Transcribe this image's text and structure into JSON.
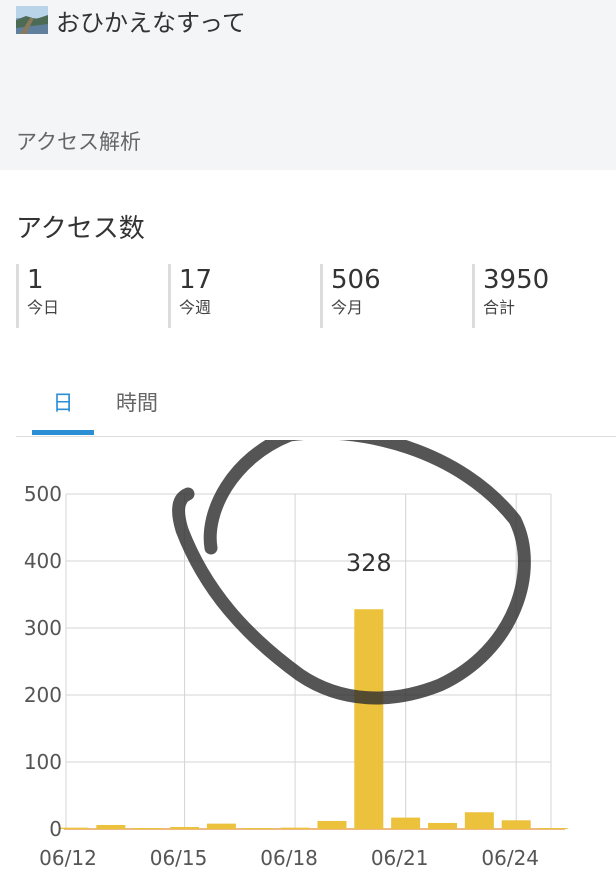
{
  "header": {
    "site_title": "おひかえなすって",
    "section_label": "アクセス解析"
  },
  "card": {
    "title": "アクセス数",
    "stats": [
      {
        "value": "1",
        "label": "今日"
      },
      {
        "value": "17",
        "label": "今週"
      },
      {
        "value": "506",
        "label": "今月"
      },
      {
        "value": "3950",
        "label": "合計"
      }
    ]
  },
  "tabs": [
    {
      "label": "日",
      "active": true
    },
    {
      "label": "時間",
      "active": false
    }
  ],
  "colors": {
    "bar": "#ecc13b",
    "accent": "#2c8fd6",
    "grid": "#d4d4d4",
    "axis_line": "#e9a35a",
    "annotation": "#2f2f2f"
  },
  "chart_data": {
    "type": "bar",
    "categories": [
      "06/12",
      "06/13",
      "06/14",
      "06/15",
      "06/16",
      "06/17",
      "06/18",
      "06/19",
      "06/20",
      "06/21",
      "06/22",
      "06/23",
      "06/24",
      "06/25"
    ],
    "values": [
      2,
      6,
      0,
      3,
      8,
      0,
      2,
      12,
      328,
      17,
      9,
      25,
      13,
      1
    ],
    "tick_labels": [
      "06/12",
      "06/15",
      "06/18",
      "06/21",
      "06/24"
    ],
    "y_ticks": [
      0,
      100,
      200,
      300,
      400,
      500
    ],
    "ylim": [
      0,
      500
    ],
    "data_labels": [
      {
        "category": "06/20",
        "text": "328"
      }
    ],
    "grid": true,
    "annotation": "hand-drawn circle around the 06/20 bar"
  }
}
